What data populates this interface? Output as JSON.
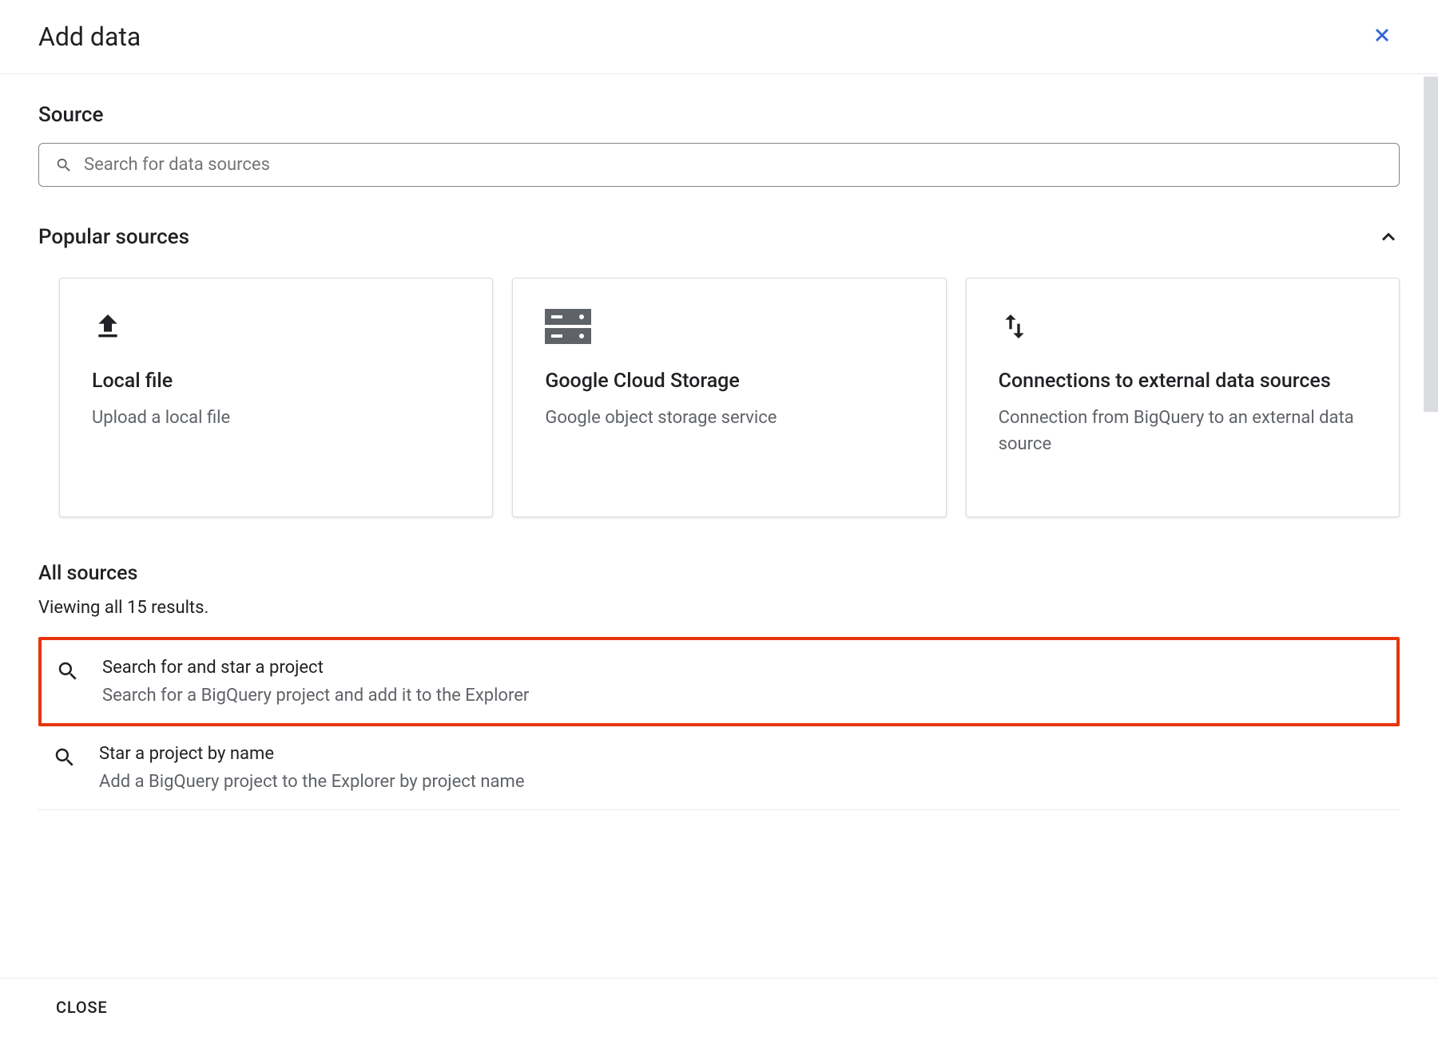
{
  "header": {
    "title": "Add data"
  },
  "source": {
    "label": "Source",
    "search_placeholder": "Search for data sources"
  },
  "popular": {
    "label": "Popular sources",
    "cards": [
      {
        "title": "Local file",
        "desc": "Upload a local file",
        "icon": "upload"
      },
      {
        "title": "Google Cloud Storage",
        "desc": "Google object storage service",
        "icon": "storage"
      },
      {
        "title": "Connections to external data sources",
        "desc": "Connection from BigQuery to an external data source",
        "icon": "swap"
      }
    ]
  },
  "all_sources": {
    "label": "All sources",
    "viewing": "Viewing all 15 results.",
    "items": [
      {
        "title": "Search for and star a project",
        "desc": "Search for a BigQuery project and add it to the Explorer",
        "icon": "search",
        "highlighted": true
      },
      {
        "title": "Star a project by name",
        "desc": "Add a BigQuery project to the Explorer by project name",
        "icon": "search",
        "highlighted": false
      }
    ]
  },
  "footer": {
    "close_label": "CLOSE"
  }
}
